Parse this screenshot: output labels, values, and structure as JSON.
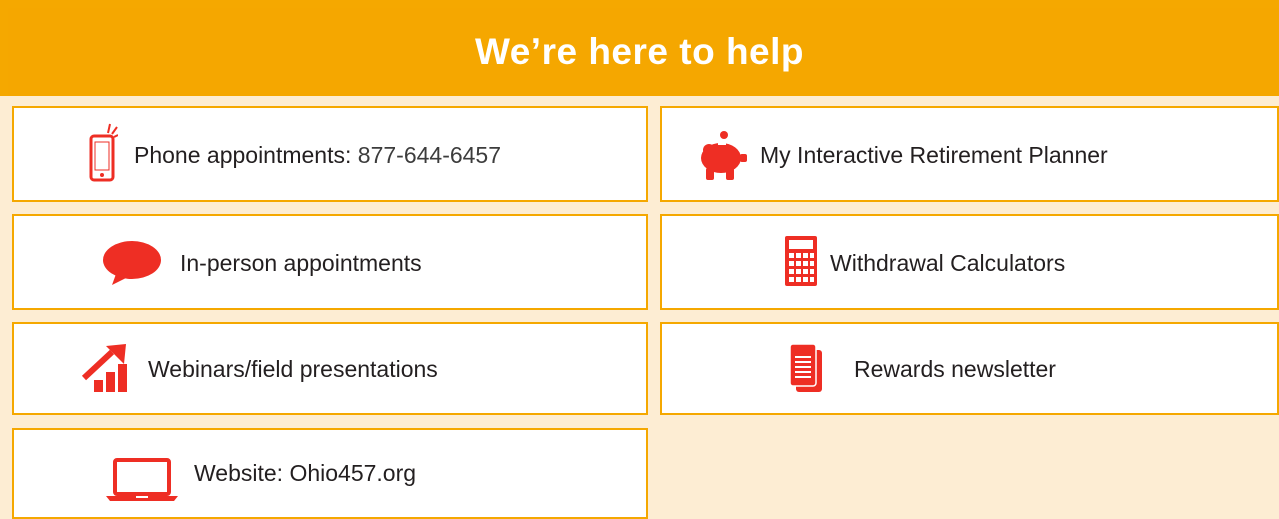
{
  "header": {
    "title": "We’re here to help"
  },
  "items": [
    {
      "label": "Phone appointments:",
      "value": " 877-644-6457",
      "icon": "mobile-phone-icon"
    },
    {
      "label": "My Interactive Retirement Planner",
      "icon": "piggy-bank-icon"
    },
    {
      "label": "In-person appointments",
      "icon": "speech-bubble-icon"
    },
    {
      "label": "Withdrawal Calculators",
      "icon": "calculator-icon"
    },
    {
      "label": "Webinars/field presentations",
      "icon": "growth-chart-icon"
    },
    {
      "label": "Rewards newsletter",
      "icon": "newsletter-icon"
    },
    {
      "label": "Website: Ohio457.org",
      "icon": "laptop-icon"
    }
  ],
  "colors": {
    "accent": "#f5a800",
    "icon": "#ee2e24",
    "background": "#fdedd3"
  }
}
